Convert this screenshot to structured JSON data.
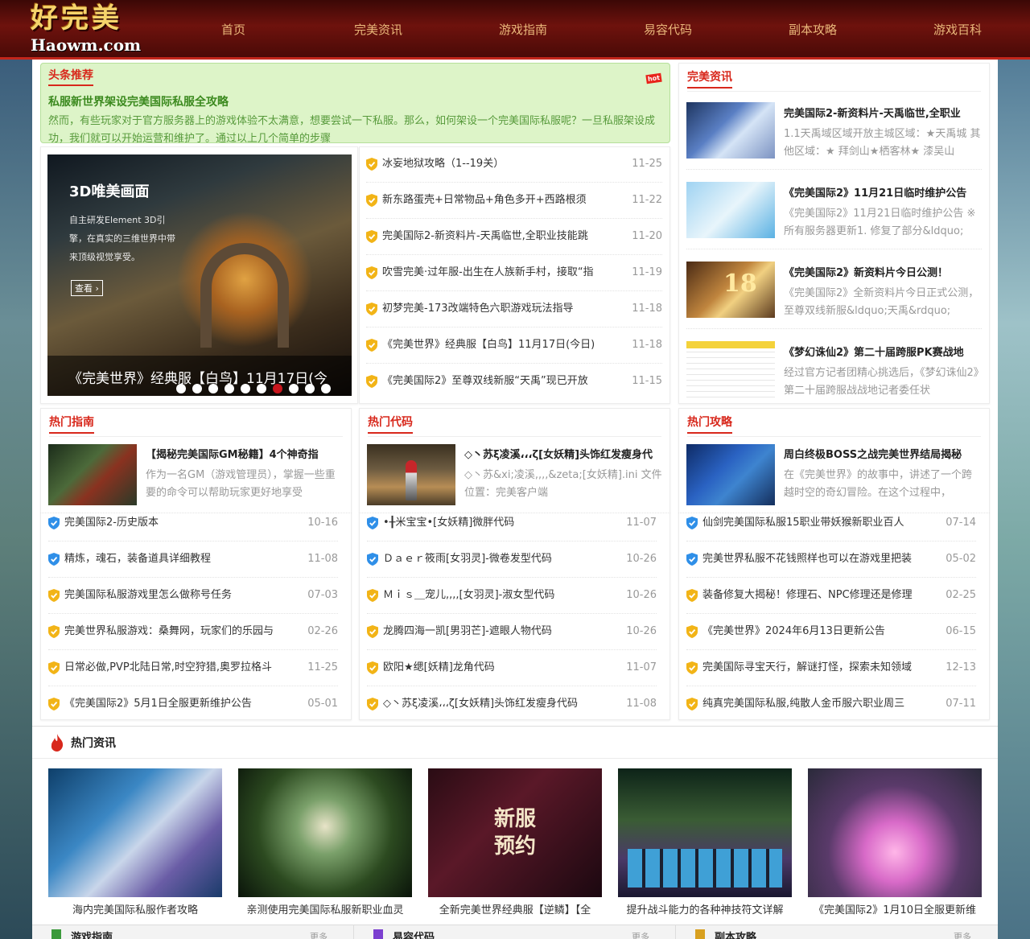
{
  "site": {
    "logo_cn": "好完美",
    "logo_en": "Haowm.com"
  },
  "nav": [
    "首页",
    "完美资讯",
    "游戏指南",
    "易容代码",
    "副本攻略",
    "游戏百科"
  ],
  "headline": {
    "tag": "头条推荐",
    "hot": "hot",
    "title": "私服新世界架设完美国际私服全攻略",
    "desc": "然而，有些玩家对于官方服务器上的游戏体验不太满意，想要尝试一下私服。那么，如何架设一个完美国际私服呢？一旦私服架设成功，我们就可以开始运营和维护了。通过以上几个简单的步骤"
  },
  "slider": {
    "heading": "3D唯美画面",
    "sub": "自主研发Element 3D引擎，在真实的三维世界中带来顶级视觉享受。",
    "button": "查看 ›",
    "caption": "《完美世界》经典服【白鸟】11月17日(今",
    "dots": 10,
    "active_dot": 7
  },
  "latest_list": [
    {
      "t": "冰妄地狱攻略（1--19关）",
      "d": "11-25"
    },
    {
      "t": "新东路蛋壳+日常物品+角色多开+西路根须",
      "d": "11-22"
    },
    {
      "t": "完美国际2-新资料片-天禹临世,全职业技能跳",
      "d": "11-20"
    },
    {
      "t": "吹雪完美·过年服-出生在人族新手村，接取“指",
      "d": "11-19"
    },
    {
      "t": "初梦完美-173改端特色六职游戏玩法指导",
      "d": "11-18"
    },
    {
      "t": "《完美世界》经典服【白鸟】11月17日(今日)",
      "d": "11-18"
    },
    {
      "t": "《完美国际2》至尊双线新服“天禹”现已开放",
      "d": "11-15"
    }
  ],
  "news_box": {
    "title": "完美资讯",
    "items": [
      {
        "t": "完美国际2-新资料片-天禹临世,全职业",
        "d": "1.1天禹域区域开放主城区域：★天禹城 其他区域：★ 拜剑山★栖客林★ 漆吴山"
      },
      {
        "t": "《完美国际2》11月21日临时维护公告",
        "d": "《完美国际2》11月21日临时维护公告 ※所有服务器更新1. 修复了部分&ldquo;"
      },
      {
        "t": "《完美国际2》新资料片今日公测！",
        "d": "《完美国际2》全新资料片今日正式公测，至尊双线新服&ldquo;天禹&rdquo;"
      },
      {
        "t": "《梦幻诛仙2》第二十届跨服PK赛战地",
        "d": "经过官方记者团精心挑选后，《梦幻诛仙2》第二十届跨服战战地记者委任状"
      }
    ],
    "thumb3": "18"
  },
  "guide_box": {
    "title": "热门指南",
    "feature": {
      "t": "【揭秘完美国际GM秘籍】4个神奇指",
      "d": "作为一名GM（游戏管理员），掌握一些重要的命令可以帮助玩家更好地享受"
    },
    "items": [
      {
        "t": "完美国际2-历史版本",
        "d": "10-16"
      },
      {
        "t": "精炼，魂石，装备道具详细教程",
        "d": "11-08"
      },
      {
        "t": "完美国际私服游戏里怎么做称号任务",
        "d": "07-03"
      },
      {
        "t": "完美世界私服游戏：桑舞网，玩家们的乐园与",
        "d": "02-26"
      },
      {
        "t": "日常必做,PVP北陆日常,时空狩猎,奥罗拉格斗",
        "d": "11-25"
      },
      {
        "t": "《完美国际2》5月1日全服更新维护公告",
        "d": "05-01"
      }
    ]
  },
  "code_box": {
    "title": "热门代码",
    "feature": {
      "t": "◇丶苏ξ凌溪،،،ζ[女妖精]头饰红发瘦身代",
      "d": "◇丶苏&xi;凌溪,,,,&zeta;[女妖精].ini 文件位置：完美客户端"
    },
    "items": [
      {
        "t": "•╂米宝宝•[女妖精]微胖代码",
        "d": "11-07"
      },
      {
        "t": "Ｄａｅｒ筱雨[女羽灵]-微卷发型代码",
        "d": "10-26"
      },
      {
        "t": "Ｍｉｓ＿宠儿,,,,[女羽灵]-淑女型代码",
        "d": "10-26"
      },
      {
        "t": "龙腾四海一凯[男羽芒]-遮眼人物代码",
        "d": "10-26"
      },
      {
        "t": "欧阳★缌[妖精]龙角代码",
        "d": "11-07"
      },
      {
        "t": "◇丶苏ξ凌溪،،،ζ[女妖精]头饰红发瘦身代码",
        "d": "11-08"
      }
    ]
  },
  "strategy_box": {
    "title": "热门攻略",
    "feature": {
      "t": "周白终极BOSS之战完美世界结局揭秘",
      "d": "在《完美世界》的故事中，讲述了一个跨越时空的奇幻冒险。在这个过程中，"
    },
    "items": [
      {
        "t": "仙剑完美国际私服15职业带妖猴新职业百人",
        "d": "07-14"
      },
      {
        "t": "完美世界私服不花钱照样也可以在游戏里把装",
        "d": "05-02"
      },
      {
        "t": "装备修复大揭秘！修理石、NPC修理还是修理",
        "d": "02-25"
      },
      {
        "t": "《完美世界》2024年6月13日更新公告",
        "d": "06-15"
      },
      {
        "t": "完美国际寻宝天行，解谜打怪，探索未知领域",
        "d": "12-13"
      },
      {
        "t": "纯真完美国际私服,纯散人金币服六职业周三",
        "d": "07-11"
      }
    ]
  },
  "hot_news": {
    "title": "热门资讯",
    "items": [
      {
        "t": "海内完美国际私服作者攻略"
      },
      {
        "t": "亲测使用完美国际私服新职业血灵"
      },
      {
        "t": "全新完美世界经典服【逆鳞】【全"
      },
      {
        "t": "提升战斗能力的各种神技符文详解"
      },
      {
        "t": "《完美国际2》1月10日全服更新维"
      }
    ],
    "poster_text": "新服预约"
  },
  "footer_tabs": [
    {
      "t": "游戏指南",
      "more": "更多"
    },
    {
      "t": "易容代码",
      "more": "更多"
    },
    {
      "t": "副本攻略",
      "more": "更多"
    }
  ],
  "colors": {
    "accent": "#d8281c",
    "header": "#6e120d",
    "green": "#3c8a1f",
    "gold_icon": "#f2b417",
    "blue_icon": "#2f8fe8"
  }
}
